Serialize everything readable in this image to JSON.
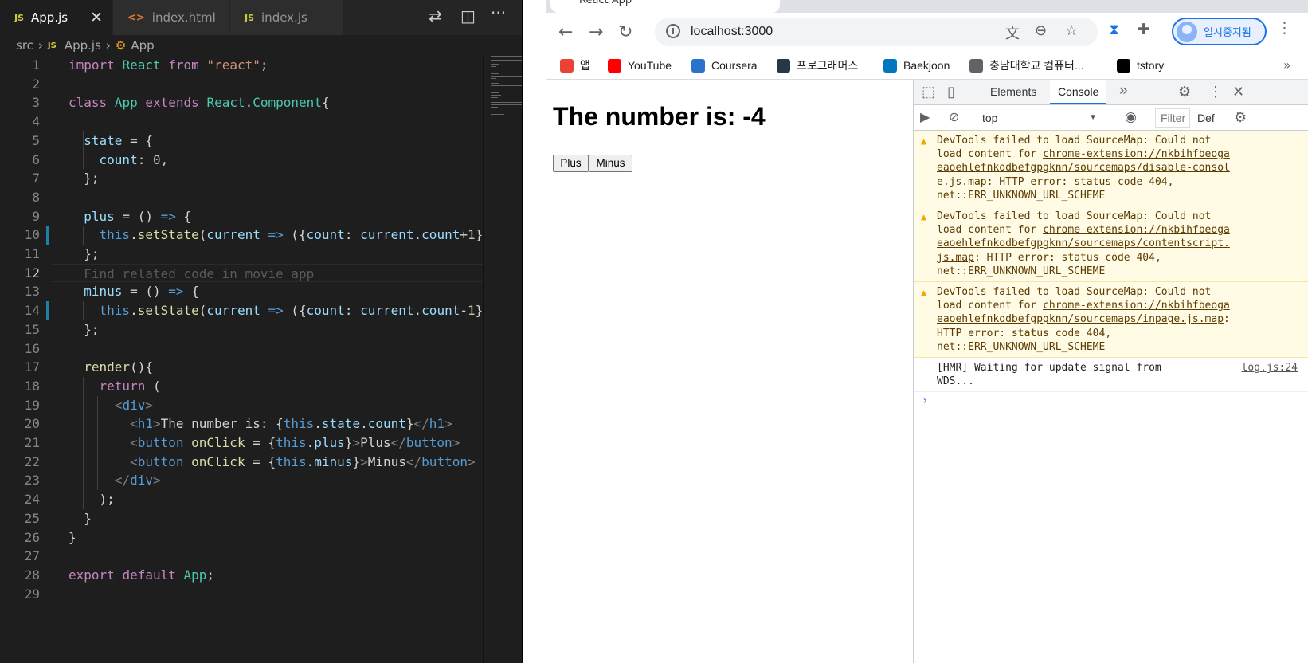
{
  "vscode": {
    "tabs": [
      {
        "type": "JS",
        "label": "App.js",
        "active": true,
        "close": "✕"
      },
      {
        "type": "<>",
        "label": "index.html",
        "active": false
      },
      {
        "type": "JS",
        "label": "index.js",
        "active": false
      }
    ],
    "breadcrumb": {
      "folder": "src",
      "file": "App.js",
      "symbol": "App"
    },
    "active_line": 12,
    "line_numbers": [
      "1",
      "2",
      "3",
      "4",
      "5",
      "6",
      "7",
      "8",
      "9",
      "10",
      "11",
      "12",
      "13",
      "14",
      "15",
      "16",
      "17",
      "18",
      "19",
      "20",
      "21",
      "22",
      "23",
      "24",
      "25",
      "26",
      "27",
      "28",
      "29"
    ],
    "code_lines": [
      "import React from \"react\";",
      "",
      "class App extends React.Component{",
      "",
      "  state = {",
      "    count: 0,",
      "  };",
      "",
      "  plus = () => {",
      "    this.setState(current => ({count: current.count+1}",
      "  };",
      "  Find related code in movie_app",
      "  minus = () => {",
      "    this.setState(current => ({count: current.count-1}",
      "  };",
      "",
      "  render(){",
      "    return (",
      "      <div>",
      "        <h1>The number is: {this.state.count}</h1>",
      "        <button onClick = {this.plus}>Plus</button>",
      "        <button onClick = {this.minus}>Minus</button>",
      "      </div>",
      "    );",
      "  }",
      "}",
      "",
      "export default App;",
      ""
    ]
  },
  "browser": {
    "tab_title": "React App",
    "url": "localhost:3000",
    "profile_label": "일시중지됨",
    "bookmarks": [
      {
        "label": "앱",
        "icon": "apps-grid-icon",
        "color": "#ea4335"
      },
      {
        "label": "YouTube",
        "icon": "youtube-icon",
        "color": "#ff0000"
      },
      {
        "label": "Coursera",
        "icon": "coursera-icon",
        "color": "#2a73cc"
      },
      {
        "label": "프로그래머스",
        "icon": "programmers-icon",
        "color": "#263747"
      },
      {
        "label": "Baekjoon",
        "icon": "baekjoon-icon",
        "color": "#0076c0"
      },
      {
        "label": "충남대학교 컴퓨터...",
        "icon": "globe-icon",
        "color": "#5f6368"
      },
      {
        "label": "tstory",
        "icon": "tistory-icon",
        "color": "#000000"
      }
    ],
    "page": {
      "heading": "The number is: -4",
      "plus_label": "Plus",
      "minus_label": "Minus"
    }
  },
  "devtools": {
    "tabs": [
      "Elements",
      "Console"
    ],
    "active_tab": "Console",
    "context": "top",
    "filter_placeholder": "Filter",
    "levels_label": "Def",
    "messages": [
      {
        "level": "warning",
        "text": "DevTools failed to load SourceMap: Could not\nload content for ",
        "link": "chrome-extension://nkbihfbeoga\neaoehlefnkodbefgpgknn/sourcemaps/disable-consol\ne.js.map",
        "tail": ": HTTP error: status code 404,\nnet::ERR_UNKNOWN_URL_SCHEME"
      },
      {
        "level": "warning",
        "text": "DevTools failed to load SourceMap: Could not\nload content for ",
        "link": "chrome-extension://nkbihfbeoga\neaoehlefnkodbefgpgknn/sourcemaps/contentscript.\njs.map",
        "tail": ": HTTP error: status code 404,\nnet::ERR_UNKNOWN_URL_SCHEME"
      },
      {
        "level": "warning",
        "text": "DevTools failed to load SourceMap: Could not\nload content for ",
        "link": "chrome-extension://nkbihfbeoga\neaoehlefnkodbefgpgknn/sourcemaps/inpage.js.map",
        "tail": ":\nHTTP error: status code 404,\nnet::ERR_UNKNOWN_URL_SCHEME"
      }
    ],
    "log": {
      "text": "[HMR] Waiting for update signal from\nWDS...",
      "source": "log.js:24"
    },
    "prompt": "›"
  }
}
